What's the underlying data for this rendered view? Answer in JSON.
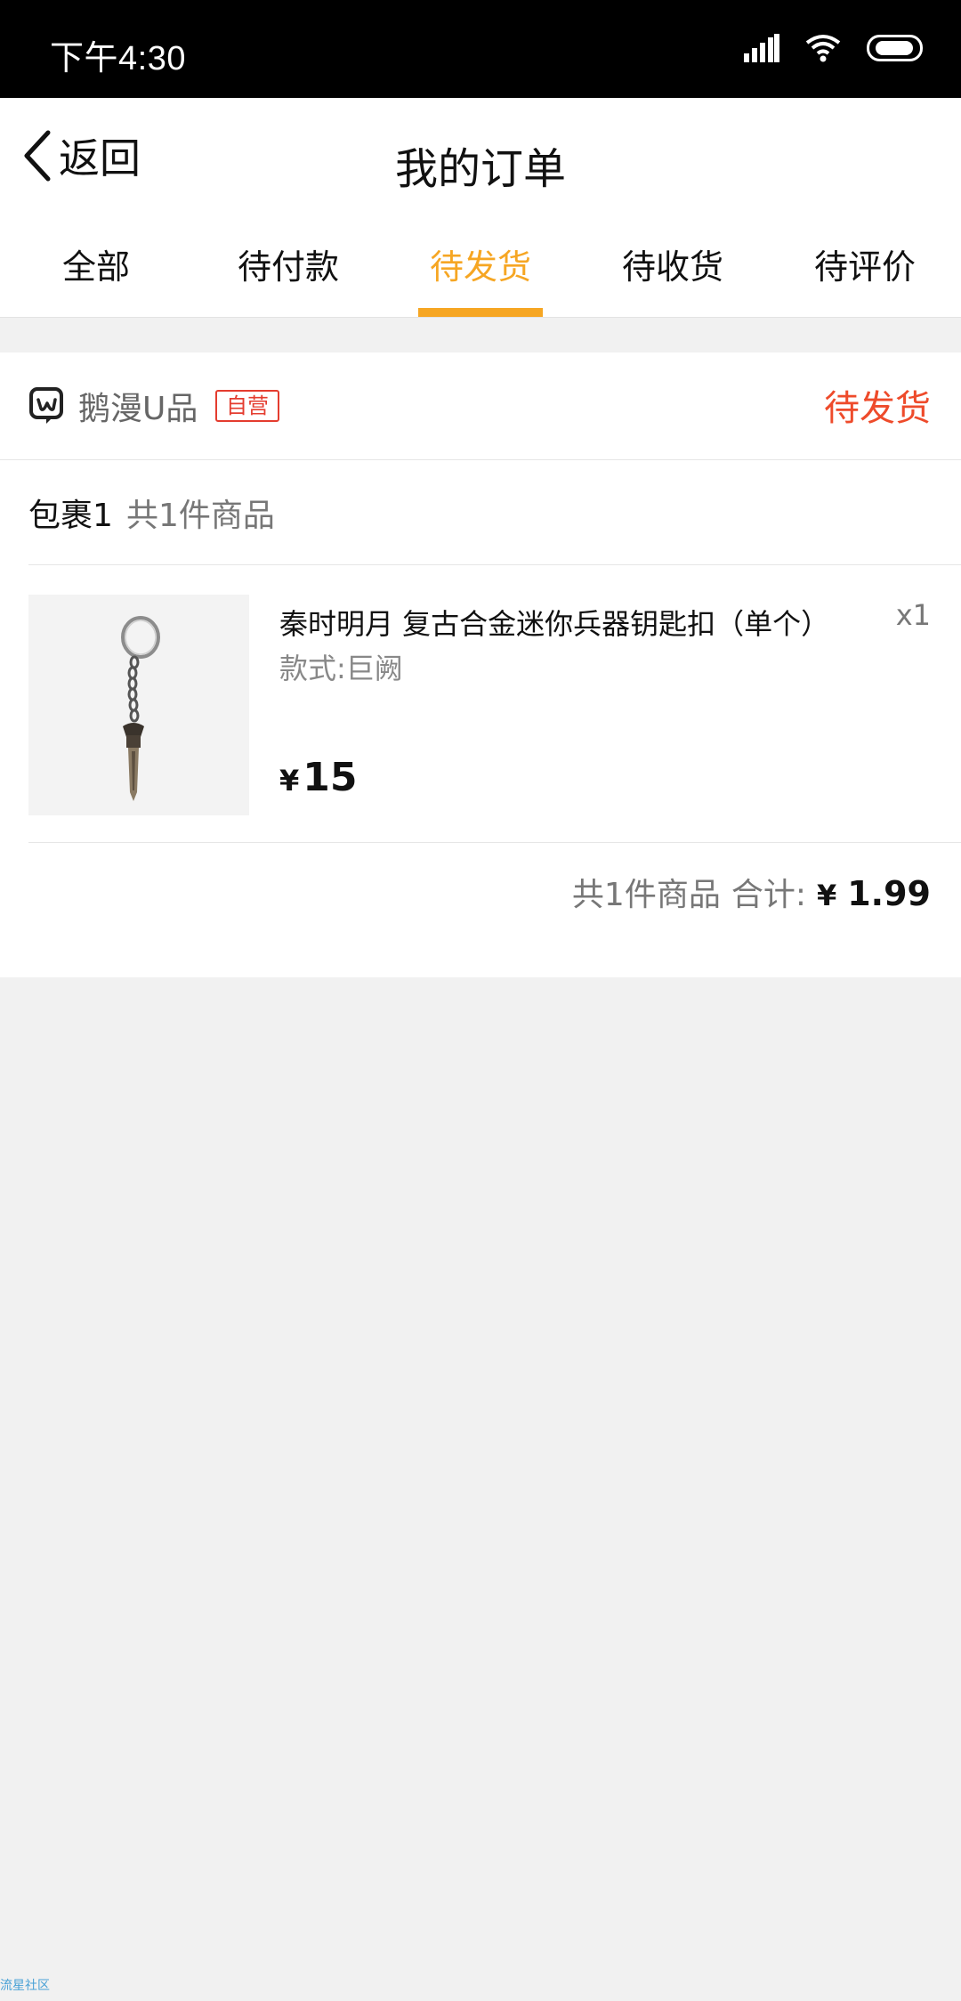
{
  "status_bar": {
    "time": "下午4:30"
  },
  "header": {
    "back_label": "返回",
    "title": "我的订单"
  },
  "tabs": [
    {
      "label": "全部",
      "active": false
    },
    {
      "label": "待付款",
      "active": false
    },
    {
      "label": "待发货",
      "active": true
    },
    {
      "label": "待收货",
      "active": false
    },
    {
      "label": "待评价",
      "active": false
    }
  ],
  "order": {
    "shop_name": "鹅漫U品",
    "shop_badge": "自营",
    "status": "待发货",
    "package": {
      "title": "包裹1",
      "count_text": "共1件商品"
    },
    "product": {
      "name": "秦时明月 复古合金迷你兵器钥匙扣（单个）",
      "variant": "款式:巨阙",
      "quantity": "x1",
      "price_symbol": "¥",
      "price": "15"
    },
    "summary": {
      "count_text": "共1件商品",
      "label": "合计:",
      "symbol": "¥",
      "total": "1.99"
    }
  },
  "watermark": "流星社区",
  "colors": {
    "accent": "#f6a623",
    "status_red": "#ee4b2b",
    "background": "#f1f1f1"
  }
}
